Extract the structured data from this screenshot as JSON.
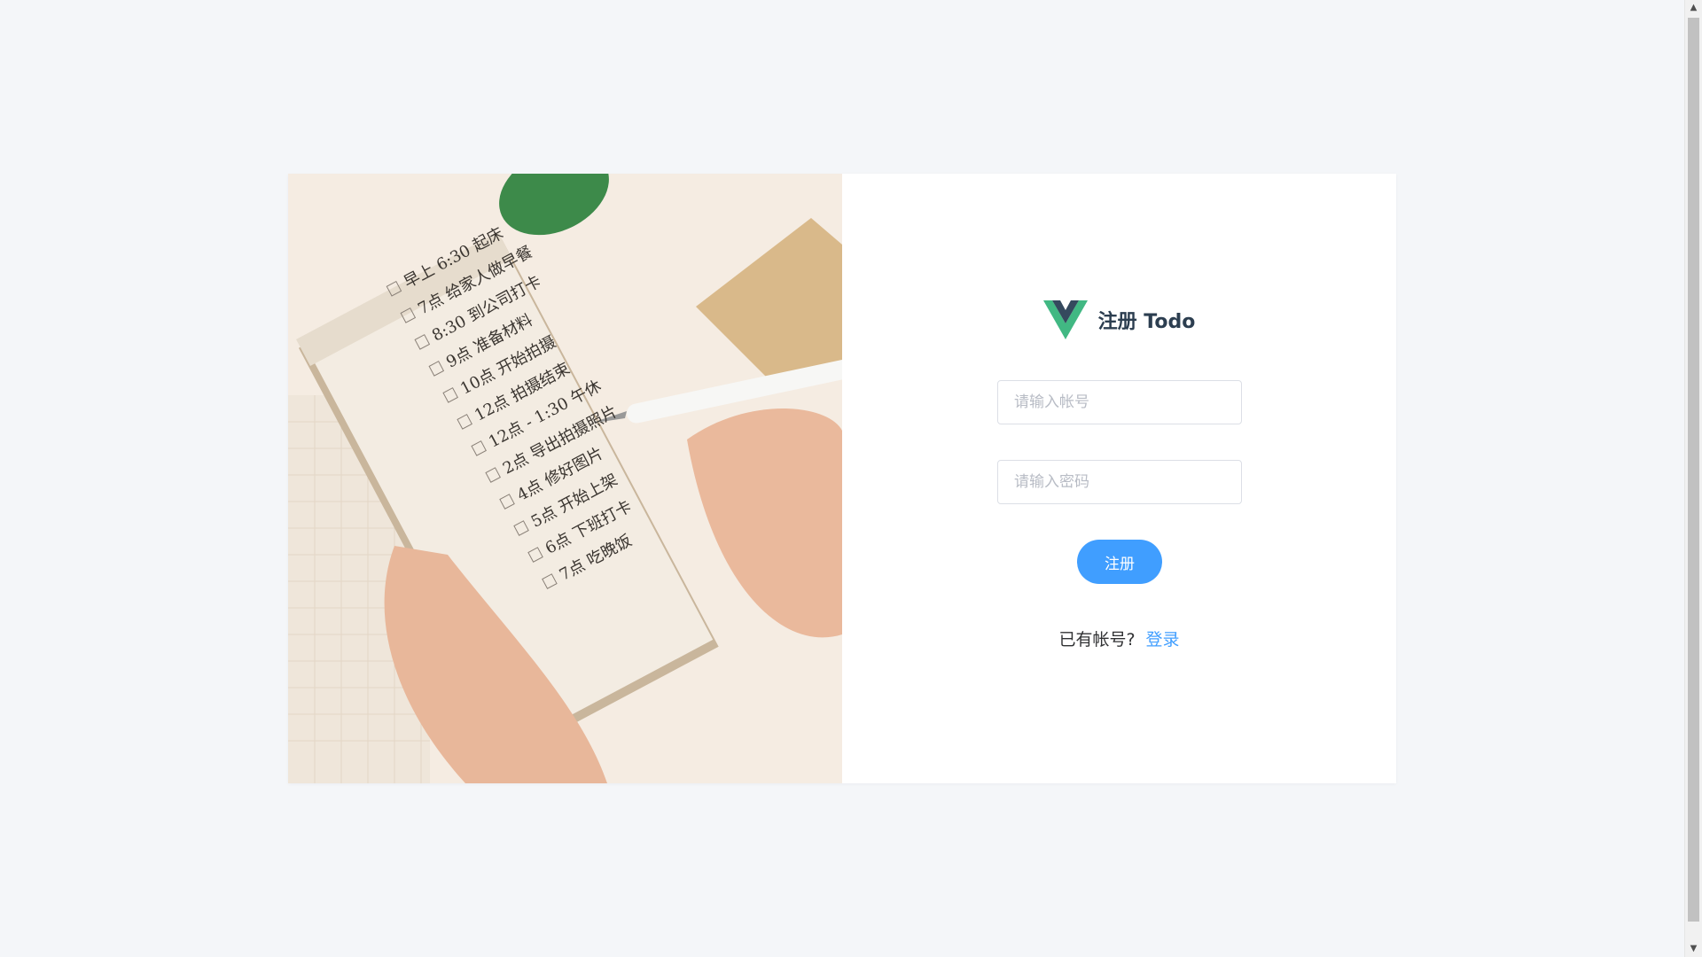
{
  "brand": {
    "title": "注册 Todo",
    "logo_icon": "vue-logo-icon",
    "logo_colors": {
      "outer": "#41b883",
      "inner": "#35495e"
    }
  },
  "form": {
    "account_placeholder": "请输入帐号",
    "password_placeholder": "请输入密码",
    "submit_label": "注册"
  },
  "switch": {
    "prompt": "已有帐号?",
    "link_label": "登录"
  },
  "illustration": {
    "todo_items": [
      "早上 6:30 起床",
      "7点 给家人做早餐",
      "8:30 到公司打卡",
      "9点 准备材料",
      "10点 开始拍摄",
      "12点 拍摄结束",
      "12点 - 1:30 午休",
      "2点 导出拍摄照片",
      "4点 修好图片",
      "5点 开始上架",
      "6点 下班打卡",
      "7点 吃晚饭"
    ]
  },
  "colors": {
    "primary": "#409eff",
    "page_bg": "#f4f6f9",
    "title": "#2c3e50"
  }
}
